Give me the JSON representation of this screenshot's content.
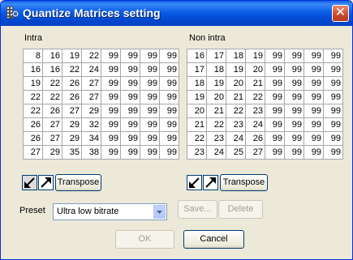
{
  "window": {
    "title": "Quantize Matrices setting",
    "close_glyph": "✕"
  },
  "intra": {
    "label": "Intra",
    "matrix": [
      [
        8,
        16,
        19,
        22,
        99,
        99,
        99,
        99
      ],
      [
        16,
        16,
        22,
        24,
        99,
        99,
        99,
        99
      ],
      [
        19,
        22,
        26,
        27,
        99,
        99,
        99,
        99
      ],
      [
        22,
        22,
        26,
        27,
        99,
        99,
        99,
        99
      ],
      [
        22,
        26,
        27,
        29,
        99,
        99,
        99,
        99
      ],
      [
        26,
        27,
        29,
        32,
        99,
        99,
        99,
        99
      ],
      [
        26,
        27,
        29,
        34,
        99,
        99,
        99,
        99
      ],
      [
        27,
        29,
        35,
        38,
        99,
        99,
        99,
        99
      ]
    ],
    "transpose_label": "Transpose"
  },
  "nonintra": {
    "label": "Non intra",
    "matrix": [
      [
        16,
        17,
        18,
        19,
        99,
        99,
        99,
        99
      ],
      [
        17,
        18,
        19,
        20,
        99,
        99,
        99,
        99
      ],
      [
        18,
        19,
        20,
        21,
        99,
        99,
        99,
        99
      ],
      [
        19,
        20,
        21,
        22,
        99,
        99,
        99,
        99
      ],
      [
        20,
        21,
        22,
        23,
        99,
        99,
        99,
        99
      ],
      [
        21,
        22,
        23,
        24,
        99,
        99,
        99,
        99
      ],
      [
        22,
        23,
        24,
        26,
        99,
        99,
        99,
        99
      ],
      [
        23,
        24,
        25,
        27,
        99,
        99,
        99,
        99
      ]
    ],
    "transpose_label": "Transpose"
  },
  "preset": {
    "label": "Preset",
    "selected": "Ultra low bitrate",
    "save_label": "Save...",
    "delete_label": "Delete"
  },
  "footer": {
    "ok_label": "OK",
    "cancel_label": "Cancel"
  },
  "icons": {
    "app": "film-icon",
    "close": "close-icon",
    "diag_down": "diagonal-arrow-down-left-icon",
    "diag_up": "diagonal-arrow-up-right-icon",
    "dropdown": "chevron-down-icon"
  },
  "colors": {
    "titlebar": "#0a5de6",
    "close": "#c8482b",
    "face": "#ece9d8",
    "grid_line": "#a7a6aa"
  }
}
